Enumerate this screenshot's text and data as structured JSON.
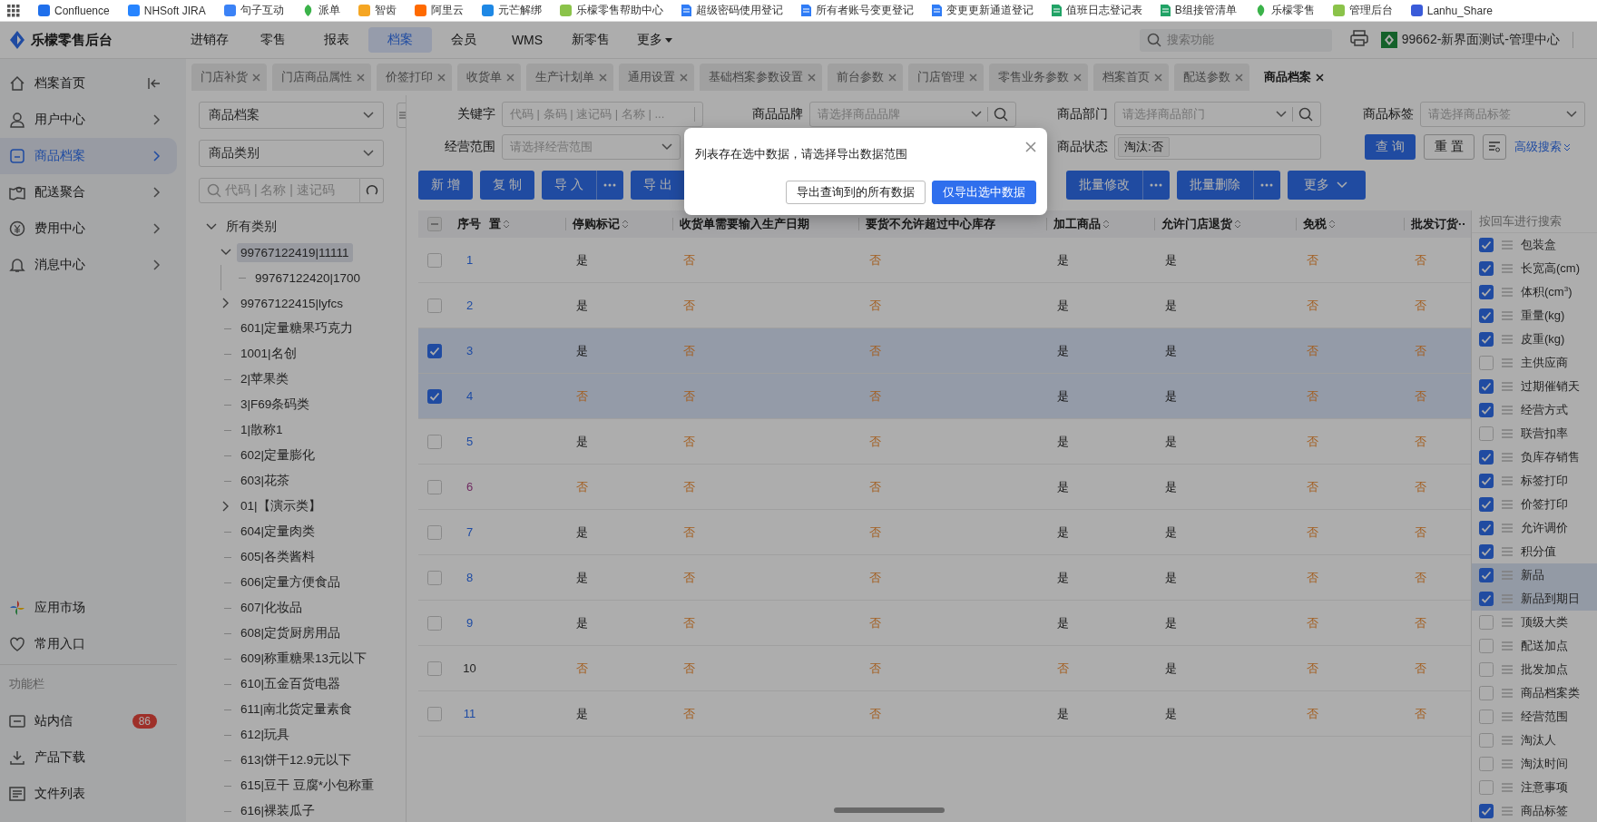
{
  "bookmarks": [
    {
      "label": "Confluence",
      "kind": "logo",
      "color": "#1f6feb"
    },
    {
      "label": "NHSoft JIRA",
      "kind": "logo",
      "color": "#2684ff"
    },
    {
      "label": "句子互动",
      "kind": "logo",
      "color": "#3b82f6"
    },
    {
      "label": "派单",
      "kind": "leaf",
      "color": "#3bb34a"
    },
    {
      "label": "智齿",
      "kind": "logo",
      "color": "#f5a623"
    },
    {
      "label": "阿里云",
      "kind": "logo",
      "color": "#ff6a00"
    },
    {
      "label": "元芒解绑",
      "kind": "logo",
      "color": "#1e88e5"
    },
    {
      "label": "乐檬零售帮助中心",
      "kind": "logo",
      "color": "#8bc34a"
    },
    {
      "label": "超级密码使用登记",
      "kind": "doc",
      "color": "#2f7cf6"
    },
    {
      "label": "所有者账号变更登记",
      "kind": "doc",
      "color": "#2f7cf6"
    },
    {
      "label": "变更更新通道登记",
      "kind": "doc",
      "color": "#2f7cf6"
    },
    {
      "label": "值班日志登记表",
      "kind": "doc",
      "color": "#21a366"
    },
    {
      "label": "B组接管清单",
      "kind": "doc",
      "color": "#21a366"
    },
    {
      "label": "乐檬零售",
      "kind": "leaf",
      "color": "#3bb34a"
    },
    {
      "label": "管理后台",
      "kind": "logo",
      "color": "#8bc34a"
    },
    {
      "label": "Lanhu_Share",
      "kind": "logo",
      "color": "#3a5bd9"
    }
  ],
  "header": {
    "title": "乐檬零售后台",
    "search_placeholder": "搜索功能",
    "org": "99662-新界面测试-管理中心",
    "nav": [
      {
        "label": "进销存",
        "selected": false,
        "dropdown": false
      },
      {
        "label": "零售",
        "selected": false,
        "dropdown": false
      },
      {
        "label": "报表",
        "selected": false,
        "dropdown": false
      },
      {
        "label": "档案",
        "selected": true,
        "dropdown": false
      },
      {
        "label": "会员",
        "selected": false,
        "dropdown": false
      },
      {
        "label": "WMS",
        "selected": false,
        "dropdown": false
      },
      {
        "label": "新零售",
        "selected": false,
        "dropdown": false
      },
      {
        "label": "更多",
        "selected": false,
        "dropdown": true
      }
    ]
  },
  "tabs": [
    {
      "label": "门店补货",
      "selected": false
    },
    {
      "label": "门店商品属性",
      "selected": false
    },
    {
      "label": "价签打印",
      "selected": false
    },
    {
      "label": "收货单",
      "selected": false
    },
    {
      "label": "生产计划单",
      "selected": false
    },
    {
      "label": "通用设置",
      "selected": false
    },
    {
      "label": "基础档案参数设置",
      "selected": false
    },
    {
      "label": "前台参数",
      "selected": false
    },
    {
      "label": "门店管理",
      "selected": false
    },
    {
      "label": "零售业务参数",
      "selected": false
    },
    {
      "label": "档案首页",
      "selected": false
    },
    {
      "label": "配送参数",
      "selected": false
    },
    {
      "label": "商品档案",
      "selected": true
    }
  ],
  "sidebar": {
    "section": "功能栏",
    "items": [
      {
        "label": "档案首页",
        "selected": false,
        "chevron": false
      },
      {
        "label": "用户中心",
        "selected": false,
        "chevron": true
      },
      {
        "label": "商品档案",
        "selected": true,
        "chevron": true
      },
      {
        "label": "配送聚合",
        "selected": false,
        "chevron": true
      },
      {
        "label": "费用中心",
        "selected": false,
        "chevron": true
      },
      {
        "label": "消息中心",
        "selected": false,
        "chevron": true
      }
    ],
    "bottom": [
      {
        "label": "应用市场"
      },
      {
        "label": "常用入口"
      }
    ],
    "tools": [
      {
        "label": "站内信",
        "badge": "86"
      },
      {
        "label": "产品下载"
      },
      {
        "label": "文件列表"
      }
    ]
  },
  "category_panel": {
    "type_select": "商品档案",
    "category_select": "商品类别",
    "search_placeholder": "代码 | 名称 | 速记码",
    "tree": [
      {
        "label": "所有类别",
        "expanded": true,
        "selected": false,
        "children": [
          {
            "label": "99767122419|11111",
            "expanded": true,
            "selected": true,
            "children": [
              {
                "label": "99767122420|1700",
                "selected": false
              }
            ]
          },
          {
            "label": "99767122415|lyfcs",
            "expanded": false,
            "selected": false
          },
          {
            "label": "601|定量糖果巧克力",
            "selected": false
          },
          {
            "label": "1001|名创",
            "selected": false
          },
          {
            "label": "2|苹果类",
            "selected": false
          },
          {
            "label": "3|F69条码类",
            "selected": false
          },
          {
            "label": "1|散称1",
            "selected": false
          },
          {
            "label": "602|定量膨化",
            "selected": false
          },
          {
            "label": "603|花茶",
            "selected": false
          },
          {
            "label": "01|【演示类】",
            "expanded": false,
            "selected": false
          },
          {
            "label": "604|定量肉类",
            "selected": false
          },
          {
            "label": "605|各类酱料",
            "selected": false
          },
          {
            "label": "606|定量方便食品",
            "selected": false
          },
          {
            "label": "607|化妆品",
            "selected": false
          },
          {
            "label": "608|定货厨房用品",
            "selected": false
          },
          {
            "label": "609|称重糖果13元以下",
            "selected": false
          },
          {
            "label": "610|五金百货电器",
            "selected": false
          },
          {
            "label": "611|南北货定量素食",
            "selected": false
          },
          {
            "label": "612|玩具",
            "selected": false
          },
          {
            "label": "613|饼干12.9元以下",
            "selected": false
          },
          {
            "label": "615|豆干 豆腐*小包称重",
            "selected": false
          },
          {
            "label": "616|裸装瓜子",
            "selected": false
          }
        ]
      }
    ]
  },
  "filters": {
    "rows": [
      [
        {
          "label": "关键字",
          "kind": "input",
          "placeholder": "代码 | 条码 | 速记码 | 名称 | ..."
        },
        {
          "label": "商品品牌",
          "kind": "select-search",
          "placeholder": "请选择商品品牌"
        },
        {
          "label": "商品部门",
          "kind": "select-search",
          "placeholder": "请选择商品部门"
        },
        {
          "label": "商品标签",
          "kind": "select",
          "placeholder": "请选择商品标签"
        }
      ],
      [
        {
          "label": "经营范围",
          "kind": "select",
          "placeholder": "请选择经营范围"
        },
        "",
        {
          "label": "商品状态",
          "kind": "tags",
          "tags": [
            "淘汰:否"
          ]
        }
      ]
    ],
    "actions": {
      "query": "查 询",
      "reset": "重 置",
      "advanced": "高级搜索"
    }
  },
  "toolbar": {
    "left": [
      {
        "label": "新 增",
        "more": false
      },
      {
        "label": "复 制",
        "more": false
      },
      {
        "label": "导 入",
        "more": true
      },
      {
        "label": "导 出",
        "more": false
      }
    ],
    "right": [
      {
        "label": "批量修改",
        "more": true
      },
      {
        "label": "批量删除",
        "more": true
      },
      {
        "label": "更多",
        "dropdown": true
      }
    ]
  },
  "table": {
    "header_checkbox": {
      "checked": false,
      "indeterminate": true
    },
    "columns": [
      {
        "label": "序号",
        "sortable": false
      },
      {
        "label": "置",
        "sortable": true
      },
      {
        "label": "停购标记",
        "sortable": true
      },
      {
        "label": "收货单需要输入生产日期",
        "sortable": false
      },
      {
        "label": "要货不允许超过中心库存",
        "sortable": false
      },
      {
        "label": "加工商品",
        "sortable": true
      },
      {
        "label": "允许门店退货",
        "sortable": true
      },
      {
        "label": "免税",
        "sortable": true
      },
      {
        "label": "批发订货··",
        "sortable": false
      }
    ],
    "rows": [
      {
        "selected": false,
        "visited": false,
        "link": true,
        "cells": [
          {
            "v": "1",
            "kind": "number"
          },
          "",
          {
            "v": "是",
            "kind": "yes"
          },
          {
            "v": "否",
            "kind": "no"
          },
          {
            "v": "否",
            "kind": "no"
          },
          {
            "v": "是",
            "kind": "yes"
          },
          {
            "v": "是",
            "kind": "yes"
          },
          {
            "v": "否",
            "kind": "no"
          },
          {
            "v": "否",
            "kind": "no"
          }
        ]
      },
      {
        "selected": false,
        "visited": false,
        "link": true,
        "cells": [
          {
            "v": "2",
            "kind": "number"
          },
          "",
          {
            "v": "是",
            "kind": "yes"
          },
          {
            "v": "否",
            "kind": "no"
          },
          {
            "v": "否",
            "kind": "no"
          },
          {
            "v": "是",
            "kind": "yes"
          },
          {
            "v": "是",
            "kind": "yes"
          },
          {
            "v": "否",
            "kind": "no"
          },
          {
            "v": "否",
            "kind": "no"
          }
        ]
      },
      {
        "selected": true,
        "visited": false,
        "link": true,
        "cells": [
          {
            "v": "3",
            "kind": "number"
          },
          "",
          {
            "v": "是",
            "kind": "yes"
          },
          {
            "v": "否",
            "kind": "no"
          },
          {
            "v": "否",
            "kind": "no"
          },
          {
            "v": "是",
            "kind": "yes"
          },
          {
            "v": "是",
            "kind": "yes"
          },
          {
            "v": "否",
            "kind": "no"
          },
          {
            "v": "否",
            "kind": "no"
          }
        ]
      },
      {
        "selected": true,
        "visited": false,
        "link": true,
        "cells": [
          {
            "v": "4",
            "kind": "number"
          },
          "",
          {
            "v": "否",
            "kind": "no"
          },
          {
            "v": "否",
            "kind": "no"
          },
          {
            "v": "否",
            "kind": "no"
          },
          {
            "v": "是",
            "kind": "yes"
          },
          {
            "v": "是",
            "kind": "yes"
          },
          {
            "v": "否",
            "kind": "no"
          },
          {
            "v": "否",
            "kind": "no"
          }
        ]
      },
      {
        "selected": false,
        "visited": false,
        "link": true,
        "cells": [
          {
            "v": "5",
            "kind": "number"
          },
          "",
          {
            "v": "是",
            "kind": "yes"
          },
          {
            "v": "否",
            "kind": "no"
          },
          {
            "v": "否",
            "kind": "no"
          },
          {
            "v": "是",
            "kind": "yes"
          },
          {
            "v": "是",
            "kind": "yes"
          },
          {
            "v": "否",
            "kind": "no"
          },
          {
            "v": "否",
            "kind": "no"
          }
        ]
      },
      {
        "selected": false,
        "visited": true,
        "link": true,
        "cells": [
          {
            "v": "6",
            "kind": "number"
          },
          "",
          {
            "v": "否",
            "kind": "no"
          },
          {
            "v": "否",
            "kind": "no"
          },
          {
            "v": "否",
            "kind": "no"
          },
          {
            "v": "是",
            "kind": "yes"
          },
          {
            "v": "是",
            "kind": "yes"
          },
          {
            "v": "否",
            "kind": "no"
          },
          {
            "v": "否",
            "kind": "no"
          }
        ]
      },
      {
        "selected": false,
        "visited": false,
        "link": true,
        "cells": [
          {
            "v": "7",
            "kind": "number"
          },
          "",
          {
            "v": "是",
            "kind": "yes"
          },
          {
            "v": "否",
            "kind": "no"
          },
          {
            "v": "否",
            "kind": "no"
          },
          {
            "v": "是",
            "kind": "yes"
          },
          {
            "v": "是",
            "kind": "yes"
          },
          {
            "v": "否",
            "kind": "no"
          },
          {
            "v": "否",
            "kind": "no"
          }
        ]
      },
      {
        "selected": false,
        "visited": false,
        "link": true,
        "cells": [
          {
            "v": "8",
            "kind": "number"
          },
          "",
          {
            "v": "是",
            "kind": "yes"
          },
          {
            "v": "否",
            "kind": "no"
          },
          {
            "v": "否",
            "kind": "no"
          },
          {
            "v": "是",
            "kind": "yes"
          },
          {
            "v": "是",
            "kind": "yes"
          },
          {
            "v": "否",
            "kind": "no"
          },
          {
            "v": "否",
            "kind": "no"
          }
        ]
      },
      {
        "selected": false,
        "visited": false,
        "link": true,
        "cells": [
          {
            "v": "9",
            "kind": "number"
          },
          "",
          {
            "v": "是",
            "kind": "yes"
          },
          {
            "v": "否",
            "kind": "no"
          },
          {
            "v": "否",
            "kind": "no"
          },
          {
            "v": "是",
            "kind": "yes"
          },
          {
            "v": "是",
            "kind": "yes"
          },
          {
            "v": "否",
            "kind": "no"
          },
          {
            "v": "否",
            "kind": "no"
          }
        ]
      },
      {
        "selected": false,
        "link": false,
        "cells": [
          {
            "v": "10",
            "kind": "number"
          },
          "",
          {
            "v": "否",
            "kind": "no"
          },
          {
            "v": "否",
            "kind": "no"
          },
          {
            "v": "否",
            "kind": "no"
          },
          {
            "v": "否",
            "kind": "no"
          },
          {
            "v": "是",
            "kind": "yes"
          },
          {
            "v": "否",
            "kind": "no"
          },
          {
            "v": "否",
            "kind": "no"
          }
        ]
      },
      {
        "selected": false,
        "visited": false,
        "link": true,
        "cells": [
          {
            "v": "11",
            "kind": "number"
          },
          "",
          {
            "v": "是",
            "kind": "yes"
          },
          {
            "v": "否",
            "kind": "no"
          },
          {
            "v": "否",
            "kind": "no"
          },
          {
            "v": "是",
            "kind": "yes"
          },
          {
            "v": "是",
            "kind": "yes"
          },
          {
            "v": "否",
            "kind": "no"
          },
          {
            "v": "否",
            "kind": "no"
          }
        ]
      }
    ]
  },
  "column_panel": {
    "search_placeholder": "按回车进行搜索",
    "items": [
      {
        "label": "包装盒",
        "checked": true,
        "selected": false
      },
      {
        "label": "长宽高(cm)",
        "checked": true,
        "selected": false
      },
      {
        "label": "体积(cm$^{3}$)",
        "checked": true,
        "selected": false
      },
      {
        "label": "重量(kg)",
        "checked": true,
        "selected": false
      },
      {
        "label": "皮重(kg)",
        "checked": true,
        "selected": false
      },
      {
        "label": "主供应商",
        "checked": false,
        "selected": false
      },
      {
        "label": "过期催销天",
        "checked": true,
        "selected": false
      },
      {
        "label": "经营方式",
        "checked": true,
        "selected": false
      },
      {
        "label": "联营扣率",
        "checked": false,
        "selected": false
      },
      {
        "label": "负库存销售",
        "checked": true,
        "selected": false
      },
      {
        "label": "标签打印",
        "checked": true,
        "selected": false
      },
      {
        "label": "价签打印",
        "checked": true,
        "selected": false
      },
      {
        "label": "允许调价",
        "checked": true,
        "selected": false
      },
      {
        "label": "积分值",
        "checked": true,
        "selected": false
      },
      {
        "label": "新品",
        "checked": true,
        "selected": true
      },
      {
        "label": "新品到期日",
        "checked": true,
        "selected": true
      },
      {
        "label": "顶级大类",
        "checked": false,
        "selected": false
      },
      {
        "label": "配送加点",
        "checked": false,
        "selected": false
      },
      {
        "label": "批发加点",
        "checked": false,
        "selected": false
      },
      {
        "label": "商品档案类",
        "checked": false,
        "selected": false
      },
      {
        "label": "经营范围",
        "checked": false,
        "selected": false
      },
      {
        "label": "淘汰人",
        "checked": false,
        "selected": false
      },
      {
        "label": "淘汰时间",
        "checked": false,
        "selected": false
      },
      {
        "label": "注意事项",
        "checked": false,
        "selected": false
      },
      {
        "label": "商品标签",
        "checked": true,
        "selected": false
      }
    ]
  },
  "modal": {
    "message": "列表存在选中数据，请选择导出数据范围",
    "buttons": [
      {
        "label": "导出查询到的所有数据",
        "primary": false
      },
      {
        "label": "仅导出选中数据",
        "primary": true
      }
    ]
  }
}
